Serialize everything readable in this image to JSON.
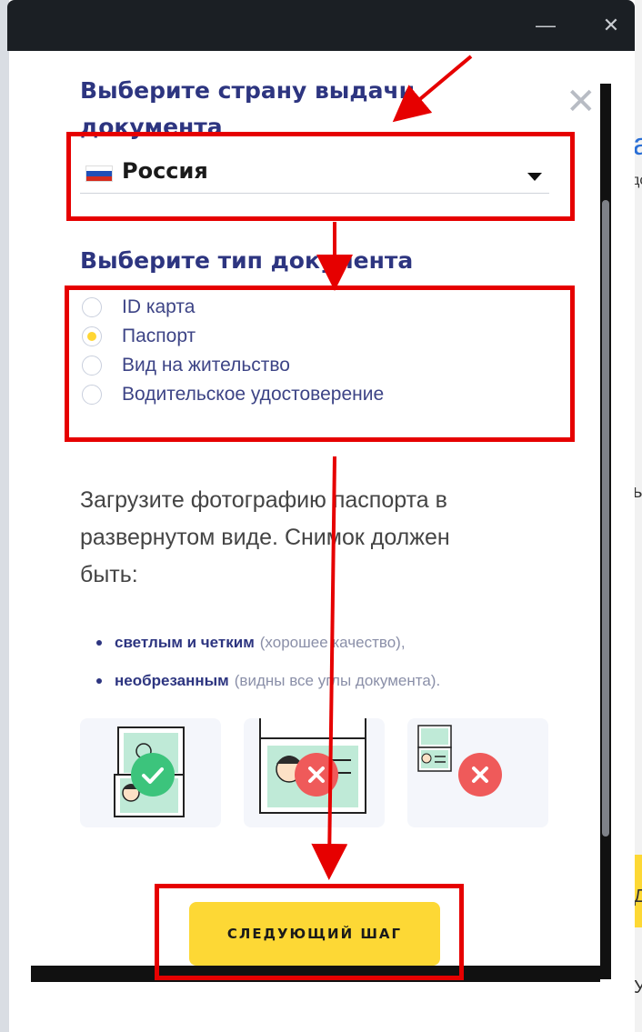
{
  "background": {
    "right_fragments": [
      "a",
      "дс",
      "ь",
      "Д",
      "У"
    ]
  },
  "window": {
    "minimize_glyph": "—",
    "close_glyph": "✕"
  },
  "modal": {
    "close_glyph": "✕",
    "country_section": {
      "heading_line1": "Выберите страну выдачи",
      "heading_line2": "документа",
      "selected_country": "Россия",
      "flag_colors": [
        "#ffffff",
        "#1f4fb8",
        "#d52b1e"
      ]
    },
    "doc_type_section": {
      "heading": "Выберите тип документа",
      "options": [
        {
          "label": "ID карта",
          "selected": false
        },
        {
          "label": "Паспорт",
          "selected": true
        },
        {
          "label": "Вид на жительство",
          "selected": false
        },
        {
          "label": "Водительское удостоверение",
          "selected": false
        }
      ]
    },
    "instructions": {
      "line1": "Загрузите фотографию паспорта в",
      "line2": "развернутом виде. Снимок должен",
      "line3": "быть:",
      "bullets": [
        {
          "bold": "светлым и четким",
          "rest": "(хорошее качество),"
        },
        {
          "bold": "необрезанным",
          "rest": "(видны все углы документа)."
        }
      ]
    },
    "examples": [
      {
        "status": "ok",
        "icon": "check-icon",
        "color": "#3cc47c"
      },
      {
        "status": "bad",
        "icon": "cross-icon",
        "color": "#ef5a5a"
      },
      {
        "status": "bad",
        "icon": "cross-icon",
        "color": "#ef5a5a"
      }
    ],
    "next_button_label": "СЛЕДУЮЩИЙ ШАГ"
  },
  "annotation_color": "#e60000",
  "accent_yellow": "#fdd835",
  "heading_color": "#2d3580"
}
